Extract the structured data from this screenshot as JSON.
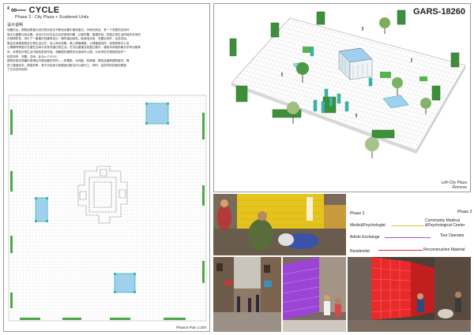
{
  "title": {
    "number": "4",
    "main": "∞— CYCLE",
    "subtitle": "Phase 3 : City Plaza + Scattered Units"
  },
  "description": {
    "heading": "设计说明",
    "lines": [
      "地震灾后，刚刚经受重大创伤的灾民在不断地余震中惶恐度日。对他们而言，有一个安稳的空间环",
      "境尤为重要与其必要。该设计针对灾后灾区的各种问题，过渡安置、重建阶段、恢复正常生活阶段的未来的",
      "灾难预防性，进行了一套循环性建筑设计，随时保回动性。能就地空间、安置空间外，动态流动、",
      "集会空间提高居民日常生活记忆，加入而水收集、墙上种植满室，以绿植能结所、信息获取中心及",
      "心理辅导等医疗支援在空间中实现关键日常生活。在灾后重建及恢复过程中，建筑本体被拆解为不同功能单",
      "体，渗透到日常生活中继续发挥作用。将解脱的建筑的化身城市公园，为未来的灾难提供庇护一",
      "轮的场所，安置、空间。此为∞-CYCLE。",
      "建筑采用实现廉价易得且可便运输的材料——质果挺、木栈板、软玻璃、脚线及面筋建筑废材。降",
      "低了建造成本，提高效率，易于灾民参与到建造过程当中以振代工。同时，这些材料的使用提高",
      "了生活空间品质。"
    ]
  },
  "plan": {
    "caption": "Phase3 Plan  1:200"
  },
  "axonometric": {
    "code": "GARS-18260",
    "caption_line1": "Left-City Plaza",
    "caption_line2": "Remove"
  },
  "legend": {
    "phase2": "Phase 2",
    "phase3": "Phase 3",
    "items": [
      {
        "label": "Medic&Psychologist",
        "color": "#e8c820"
      },
      {
        "label": "Article Exchange",
        "color": "#9b59d0"
      },
      {
        "label": "Residential",
        "color": "#e03030"
      }
    ],
    "right_items": [
      {
        "label": "Community Medical\n&Psychological Center",
        "color": "#e8c820"
      },
      {
        "label": "Tour Operator",
        "color": "#9b59d0"
      },
      {
        "label": "Reconstruction Material",
        "color": "#e03030"
      }
    ]
  },
  "colors": {
    "unit_blue": "#8cc4e8",
    "unit_teal": "#3ab6b0",
    "green_wall": "#3d8f3a",
    "grid_line": "#c8c8c8",
    "medic_yellow": "#e8c820",
    "exchange_purple": "#9b59d0",
    "residential_red": "#e03030"
  }
}
